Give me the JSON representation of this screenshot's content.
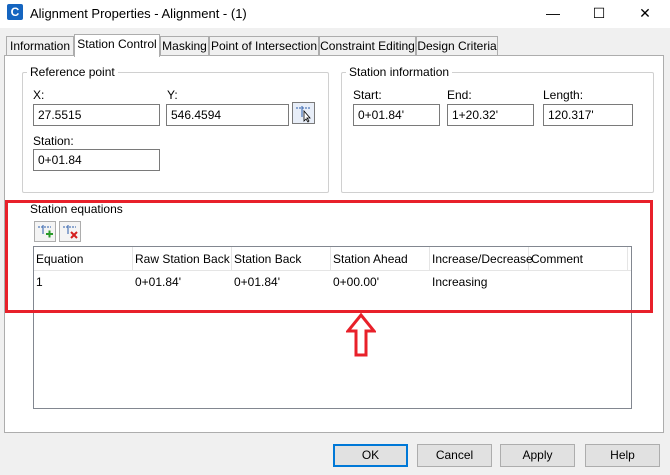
{
  "window": {
    "app_icon_letter": "C",
    "title": "Alignment Properties - Alignment - (1)",
    "minimize_glyph": "—",
    "maximize_glyph": "☐",
    "close_glyph": "✕"
  },
  "tabs": [
    {
      "label": "Information",
      "active": false
    },
    {
      "label": "Station Control",
      "active": true
    },
    {
      "label": "Masking",
      "active": false
    },
    {
      "label": "Point of Intersection",
      "active": false
    },
    {
      "label": "Constraint Editing",
      "active": false
    },
    {
      "label": "Design Criteria",
      "active": false
    }
  ],
  "reference_point": {
    "title": "Reference point",
    "x_label": "X:",
    "x_value": "27.5515",
    "y_label": "Y:",
    "y_value": "546.4594",
    "station_label": "Station:",
    "station_value": "0+01.84",
    "pick_icon": "pick-point-icon"
  },
  "station_information": {
    "title": "Station information",
    "start_label": "Start:",
    "start_value": "0+01.84'",
    "end_label": "End:",
    "end_value": "1+20.32'",
    "length_label": "Length:",
    "length_value": "120.317'"
  },
  "station_equations": {
    "title": "Station equations",
    "add_icon": "add-equation-icon",
    "delete_icon": "delete-equation-icon",
    "columns": [
      "Equation",
      "Raw Station Back",
      "Station Back",
      "Station Ahead",
      "Increase/Decrease",
      "Comment"
    ],
    "rows": [
      [
        "1",
        "0+01.84'",
        "0+01.84'",
        "0+00.00'",
        "Increasing",
        ""
      ]
    ]
  },
  "annotation": {
    "color": "#e8202a"
  },
  "buttons": {
    "ok": "OK",
    "cancel": "Cancel",
    "apply": "Apply",
    "help": "Help"
  }
}
